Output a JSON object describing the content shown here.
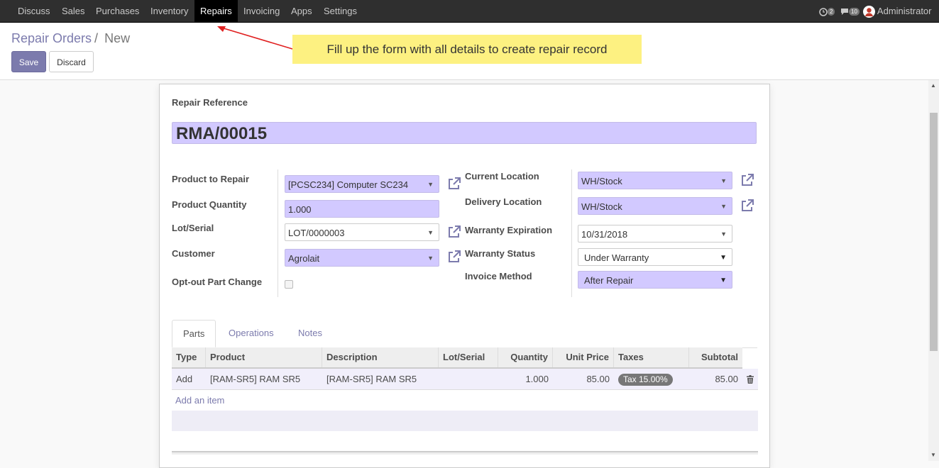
{
  "navbar": {
    "menu": [
      "Discuss",
      "Sales",
      "Purchases",
      "Inventory",
      "Repairs",
      "Invoicing",
      "Apps",
      "Settings"
    ],
    "active": "Repairs",
    "activity_count": "2",
    "message_count": "10",
    "user": "Administrator"
  },
  "breadcrumb": {
    "parent": "Repair Orders",
    "separator": "/",
    "current": "New"
  },
  "buttons": {
    "save": "Save",
    "discard": "Discard"
  },
  "callout": "Fill up the form with all details to create repair record",
  "form": {
    "ref_label": "Repair Reference",
    "ref_value": "RMA/00015",
    "product_label": "Product to Repair",
    "product_value": "[PCSC234] Computer SC234",
    "qty_label": "Product Quantity",
    "qty_value": "1.000",
    "lot_label": "Lot/Serial",
    "lot_value": "LOT/0000003",
    "customer_label": "Customer",
    "customer_value": "Agrolait",
    "optout_label": "Opt-out Part Change",
    "current_loc_label": "Current Location",
    "current_loc_value": "WH/Stock",
    "delivery_loc_label": "Delivery Location",
    "delivery_loc_value": "WH/Stock",
    "warranty_exp_label": "Warranty Expiration",
    "warranty_exp_value": "10/31/2018",
    "warranty_status_label": "Warranty Status",
    "warranty_status_value": "Under Warranty",
    "invoice_method_label": "Invoice Method",
    "invoice_method_value": "After Repair"
  },
  "tabs": [
    "Parts",
    "Operations",
    "Notes"
  ],
  "table": {
    "columns": [
      "Type",
      "Product",
      "Description",
      "Lot/Serial",
      "Quantity",
      "Unit Price",
      "Taxes",
      "Subtotal"
    ],
    "rows": [
      {
        "type": "Add",
        "product": "[RAM-SR5] RAM SR5",
        "description": "[RAM-SR5] RAM SR5",
        "lot": "",
        "quantity": "1.000",
        "unit_price": "85.00",
        "taxes": "Tax 15.00%",
        "subtotal": "85.00"
      }
    ],
    "add_item": "Add an item"
  },
  "colors": {
    "primary": "#7c7bad",
    "required_field": "#d2c9ff",
    "callout": "#fdf181",
    "navbar": "#2f2f2f"
  }
}
